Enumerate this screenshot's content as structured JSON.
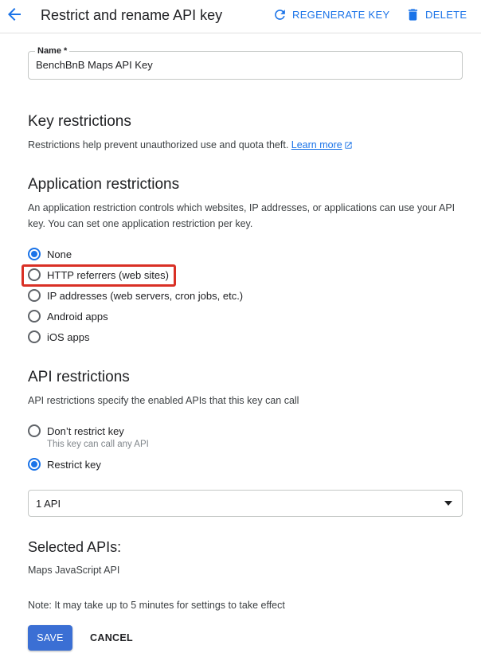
{
  "header": {
    "title": "Restrict and rename API key",
    "back_icon": "arrow-back-icon",
    "regenerate_label": "REGENERATE KEY",
    "regenerate_icon": "refresh-icon",
    "delete_label": "DELETE",
    "delete_icon": "trash-icon",
    "accent_color": "#1a73e8"
  },
  "name_field": {
    "label": "Name *",
    "value": "BenchBnB Maps API Key"
  },
  "key_restrictions": {
    "heading": "Key restrictions",
    "description": "Restrictions help prevent unauthorized use and quota theft.",
    "learn_more": "Learn more"
  },
  "application_restrictions": {
    "heading": "Application restrictions",
    "description": "An application restriction controls which websites, IP addresses, or applications can use your API key. You can set one application restriction per key.",
    "options": [
      {
        "label": "None",
        "checked": true
      },
      {
        "label": "HTTP referrers (web sites)",
        "checked": false,
        "highlighted": true
      },
      {
        "label": "IP addresses (web servers, cron jobs, etc.)",
        "checked": false
      },
      {
        "label": "Android apps",
        "checked": false
      },
      {
        "label": "iOS apps",
        "checked": false
      }
    ],
    "highlight_color": "#d93025"
  },
  "api_restrictions": {
    "heading": "API restrictions",
    "description": "API restrictions specify the enabled APIs that this key can call",
    "options": [
      {
        "label": "Don’t restrict key",
        "checked": false,
        "sublabel": "This key can call any API"
      },
      {
        "label": "Restrict key",
        "checked": true
      }
    ],
    "select_value": "1 API"
  },
  "selected_apis": {
    "heading": "Selected APIs:",
    "items": [
      "Maps JavaScript API"
    ]
  },
  "note": "Note: It may take up to 5 minutes for settings to take effect",
  "actions": {
    "save_label": "SAVE",
    "cancel_label": "CANCEL",
    "save_color": "#3b6fd4"
  }
}
